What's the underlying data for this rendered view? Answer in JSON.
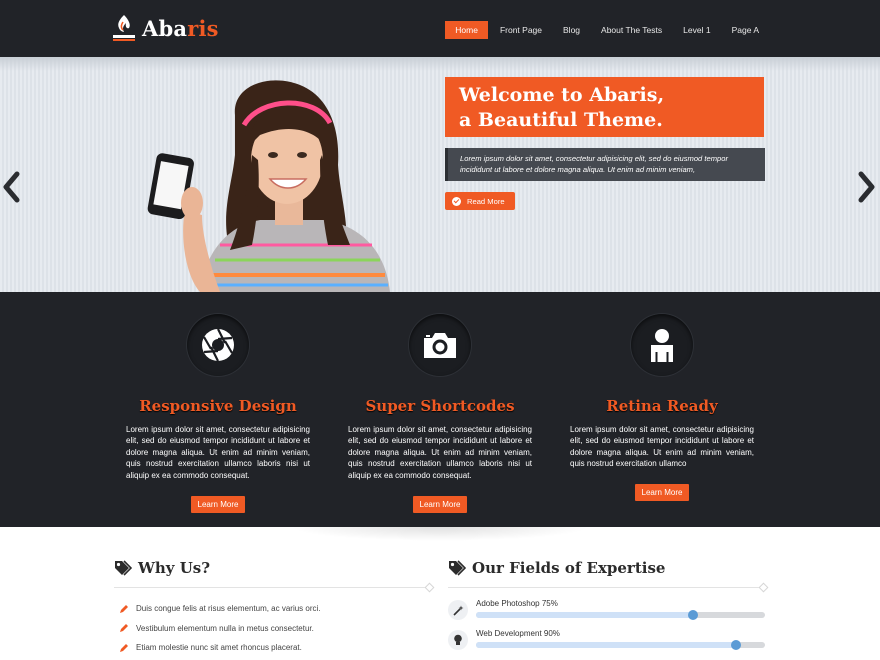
{
  "header": {
    "logo_main": "Aba",
    "logo_accent": "ris",
    "nav": [
      {
        "label": "Home",
        "active": true
      },
      {
        "label": "Front Page",
        "active": false
      },
      {
        "label": "Blog",
        "active": false
      },
      {
        "label": "About The Tests",
        "active": false
      },
      {
        "label": "Level 1",
        "active": false
      },
      {
        "label": "Page A",
        "active": false
      }
    ]
  },
  "hero": {
    "title_line1": "Welcome to Abaris,",
    "title_line2": "a Beautiful Theme.",
    "description": "Lorem ipsum dolor sit amet, consectetur adipisicing elit, sed do eiusmod tempor incididunt ut labore et dolore magna aliqua. Ut enim ad minim veniam,",
    "button_label": "Read More",
    "arrow_left_icon": "chevron-left-icon",
    "arrow_right_icon": "chevron-right-icon"
  },
  "features": [
    {
      "icon": "aperture-icon",
      "title": "Responsive Design",
      "text": "Lorem ipsum dolor sit amet, consectetur adipisicing elit, sed do eiusmod tempor incididunt ut labore et dolore magna aliqua. Ut enim ad minim veniam, quis nostrud exercitation ullamco laboris nisi ut aliquip ex ea commodo consequat.",
      "button": "Learn More"
    },
    {
      "icon": "camera-icon",
      "title": "Super Shortcodes",
      "text": "Lorem ipsum dolor sit amet, consectetur adipisicing elit, sed do eiusmod tempor incididunt ut labore et dolore magna aliqua. Ut enim ad minim veniam, quis nostrud exercitation ullamco laboris nisi ut aliquip ex ea commodo consequat.",
      "button": "Learn More"
    },
    {
      "icon": "user-icon",
      "title": "Retina Ready",
      "text": "Lorem ipsum dolor sit amet, consectetur adipisicing elit, sed do eiusmod tempor incididunt ut labore et dolore magna aliqua. Ut enim ad minim veniam, quis nostrud exercitation ullamco",
      "button": "Learn More"
    }
  ],
  "why_us": {
    "title": "Why Us?",
    "icon": "tags-icon",
    "items": [
      "Duis congue felis at risus elementum, ac varius orci.",
      "Vestibulum elementum nulla in metus consectetur.",
      "Etiam molestie nunc sit amet rhoncus placerat."
    ]
  },
  "expertise": {
    "title": "Our Fields of Expertise",
    "icon": "tags-icon",
    "skills": [
      {
        "label": "Adobe Photoshop 75%",
        "percent": 75,
        "icon": "magic-wand-icon"
      },
      {
        "label": "Web Development 90%",
        "percent": 90,
        "icon": "lightbulb-icon"
      }
    ]
  },
  "colors": {
    "accent": "#f05a24",
    "dark": "#212328",
    "progress_knob": "#5b9bd5"
  }
}
